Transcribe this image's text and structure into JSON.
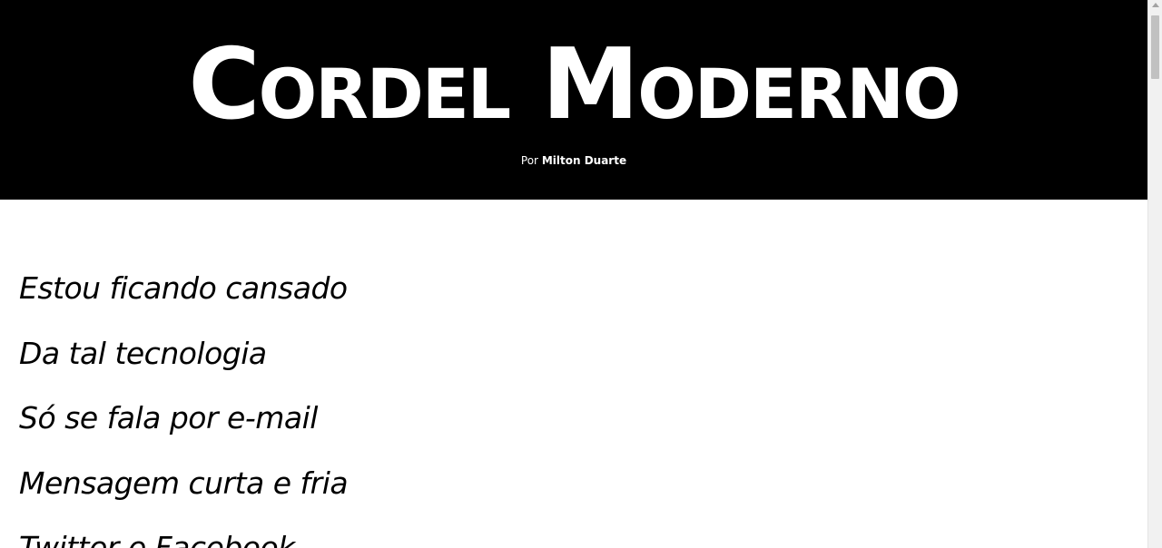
{
  "header": {
    "title": "Cordel Moderno",
    "byline_prefix": "Por",
    "byline_author": "Milton Duarte"
  },
  "poem": {
    "verses": [
      "Estou ficando cansado",
      "Da tal tecnologia",
      "Só se fala por e-mail",
      "Mensagem curta e fria",
      "Twitter e Facebook"
    ]
  },
  "scrollbar": {
    "position_fraction": 0.0
  },
  "colors": {
    "header_background": "#000000",
    "header_text": "#ffffff",
    "body_background": "#ffffff",
    "body_text": "#000000"
  }
}
